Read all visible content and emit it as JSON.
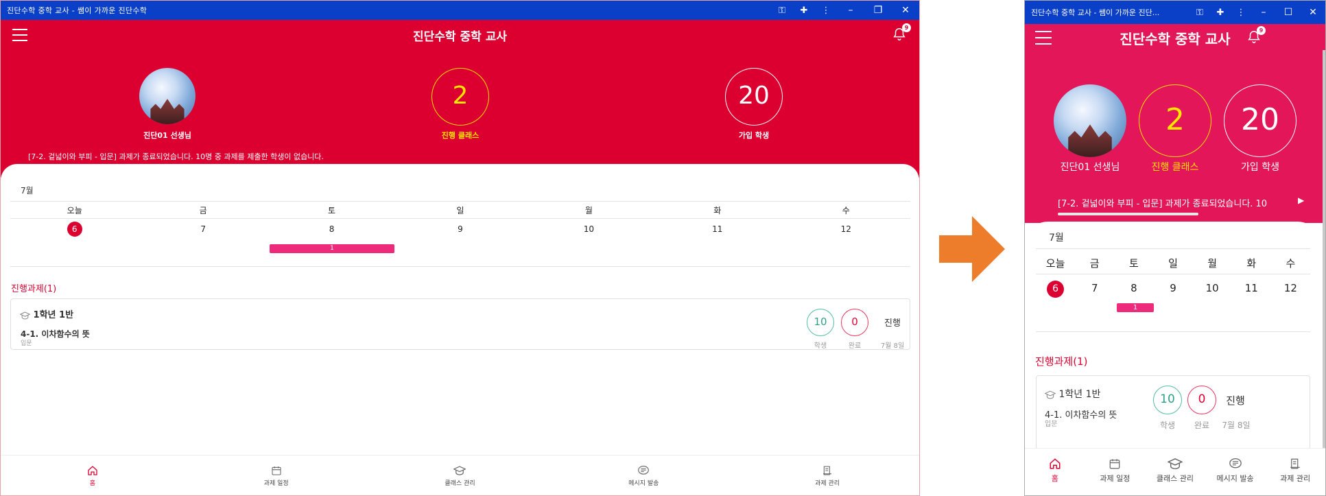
{
  "window_title": "진단수학 중학 교사 - 쌤이 가까운 진단수학",
  "window_title_short": "진단수학 중학 교사 - 쌤이 가까운 진단...",
  "app_title": "진단수학 중학 교사",
  "notification_count": "9",
  "profile": {
    "name": "진단01 선생님"
  },
  "stats": {
    "active_classes": {
      "value": "2",
      "label": "진행 클래스"
    },
    "students": {
      "value": "20",
      "label": "가입 학생"
    }
  },
  "notice": "[7-2. 겉넓이와 부피 - 입문] 과제가 종료되었습니다. 10명 중 과제를 제출한 학생이 없습니다.",
  "notice_short": "[7-2. 겉넓이와 부피 - 입문] 과제가 종료되었습니다. 10",
  "calendar": {
    "month": "7월",
    "weekdays": [
      "오늘",
      "금",
      "토",
      "일",
      "월",
      "화",
      "수"
    ],
    "dates": [
      "6",
      "7",
      "8",
      "9",
      "10",
      "11",
      "12"
    ],
    "event_count": "1"
  },
  "tasks_section": "진행과제(1)",
  "task": {
    "class_name": "1학년 1반",
    "title": "4-1. 이차함수의 뜻",
    "level": "입문",
    "students": "10",
    "students_label": "학생",
    "completed": "0",
    "completed_label": "완료",
    "status": "진행",
    "due": "7월 8일"
  },
  "nav": {
    "home": "홈",
    "schedule": "과제 일정",
    "class": "클래스 관리",
    "message": "메시지 발송",
    "assignment": "과제 관리"
  },
  "colors": {
    "header_red": "#dc0030",
    "header_pink": "#e21658",
    "titlebar": "#0a3fc7",
    "arrow": "#ee7d2b",
    "accent_yellow": "#ffe400"
  }
}
